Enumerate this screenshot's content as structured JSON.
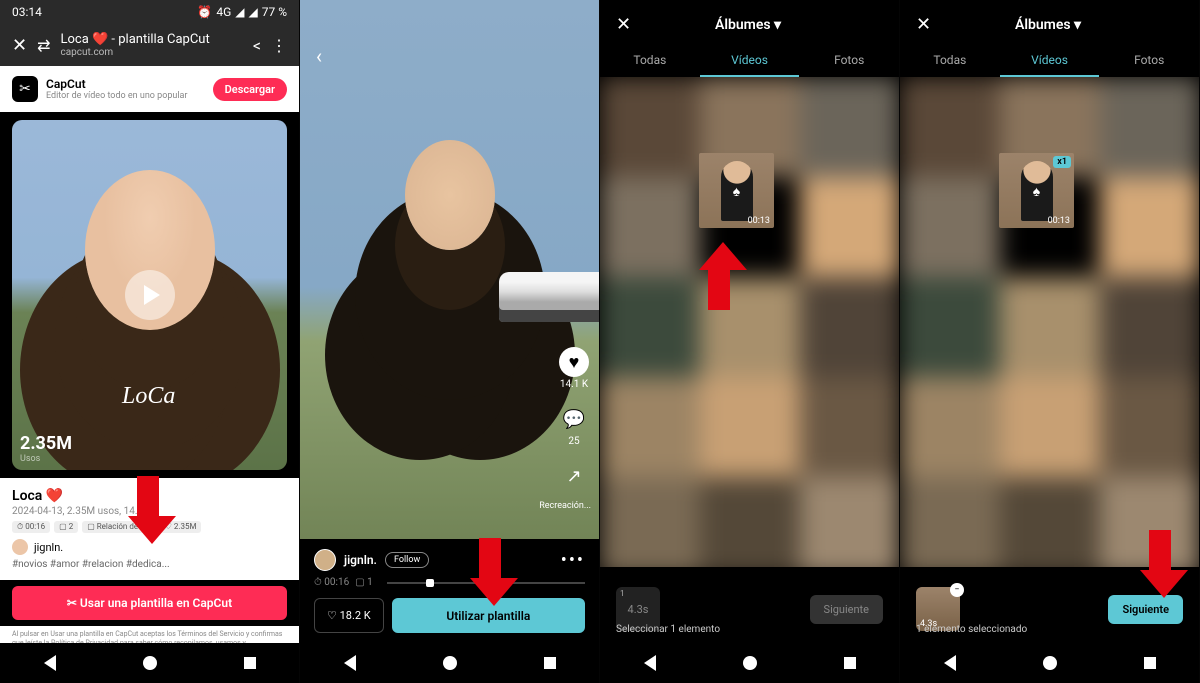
{
  "s1": {
    "time": "03:14",
    "battery": "77 %",
    "net": "4G",
    "pageTitle": "Loca ❤️ - plantilla CapCut",
    "pageSub": "capcut.com",
    "appName": "CapCut",
    "appDesc": "Editor de vídeo todo en uno popular",
    "download": "Descargar",
    "script": "LoCa",
    "usosLabel": "Usos",
    "usosNum": "2.35M",
    "title": "Loca ❤️",
    "dateline": "2024-04-13, 2.35M usos, 14.18K",
    "chip1": "⏱ 00:16",
    "chip2": "▢ 2",
    "chip3": "▢ Relación de a...",
    "chip4": "♡ 2.35M",
    "author": "jignln.",
    "tags": "#novios #amor #relacion #dedica...",
    "cta": "Usar una plantilla en CapCut",
    "legal": "Al pulsar en Usar una plantilla en CapCut aceptas los Términos del Servicio y confirmas que leíste la Política de Privacidad para saber cómo recopilamos, usamos y compartimos tus datos."
  },
  "s2": {
    "likes": "14.1 K",
    "comments": "25",
    "recr": "Recreación...",
    "author": "jignln.",
    "follow": "Follow",
    "duration": "⏱ 00:16",
    "clips": "▢ 1",
    "saves": "♡ 18.2 K",
    "use": "Utilizar plantilla"
  },
  "s3": {
    "title": "Álbumes ▾",
    "tabAll": "Todas",
    "tabVid": "Vídeos",
    "tabPhoto": "Fotos",
    "dur": "00:13",
    "slotN": "1",
    "slotDur": "4.3s",
    "select": "Seleccionar 1 elemento",
    "next": "Siguiente"
  },
  "s4": {
    "title": "Álbumes ▾",
    "tabAll": "Todas",
    "tabVid": "Vídeos",
    "tabPhoto": "Fotos",
    "dur": "00:13",
    "sel": "x1",
    "slotDur": "4.3s",
    "status": "1 elemento seleccionado",
    "next": "Siguiente"
  }
}
